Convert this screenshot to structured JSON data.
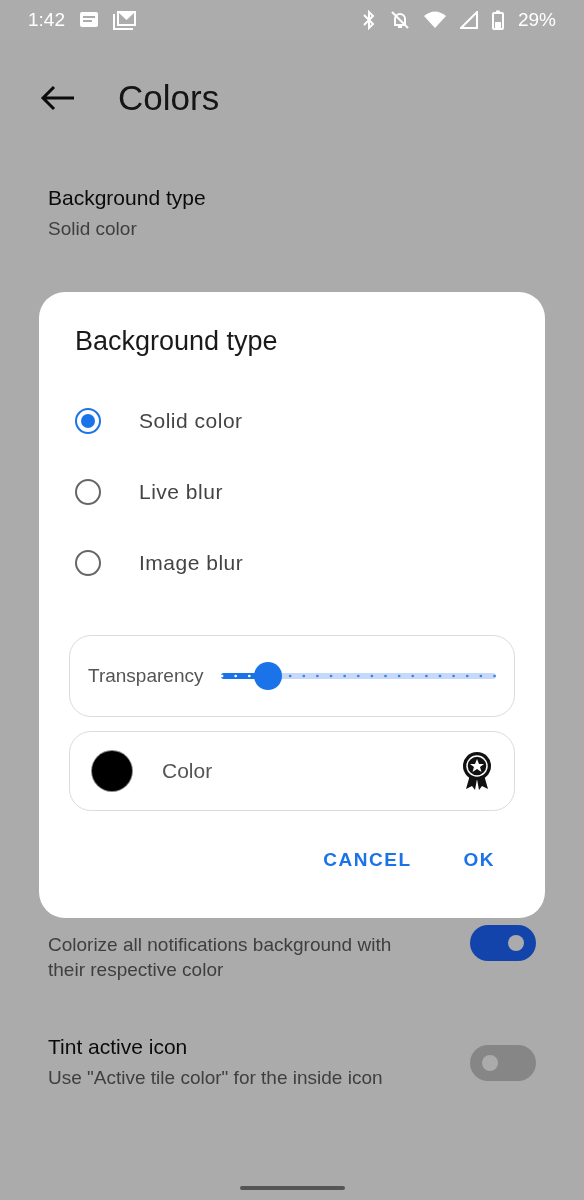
{
  "status_bar": {
    "time": "1:42",
    "battery": "29%"
  },
  "toolbar": {
    "title": "Colors"
  },
  "settings": [
    {
      "kind": "text",
      "title": "Background type",
      "subtitle": "Solid color"
    },
    {
      "kind": "toggle",
      "subtitle": "Colorize all notifications background with their respective color",
      "on": true
    },
    {
      "kind": "toggle",
      "title": "Tint active icon",
      "subtitle": "Use \"Active tile color\" for the inside icon",
      "on": false
    }
  ],
  "dialog": {
    "title": "Background type",
    "options": [
      {
        "label": "Solid color",
        "selected": true
      },
      {
        "label": "Live blur",
        "selected": false
      },
      {
        "label": "Image blur",
        "selected": false
      }
    ],
    "transparency": {
      "label": "Transparency",
      "level": 0.17
    },
    "color": {
      "label": "Color",
      "color": "#000000"
    },
    "buttons": [
      "CANCEL",
      "OK"
    ]
  }
}
